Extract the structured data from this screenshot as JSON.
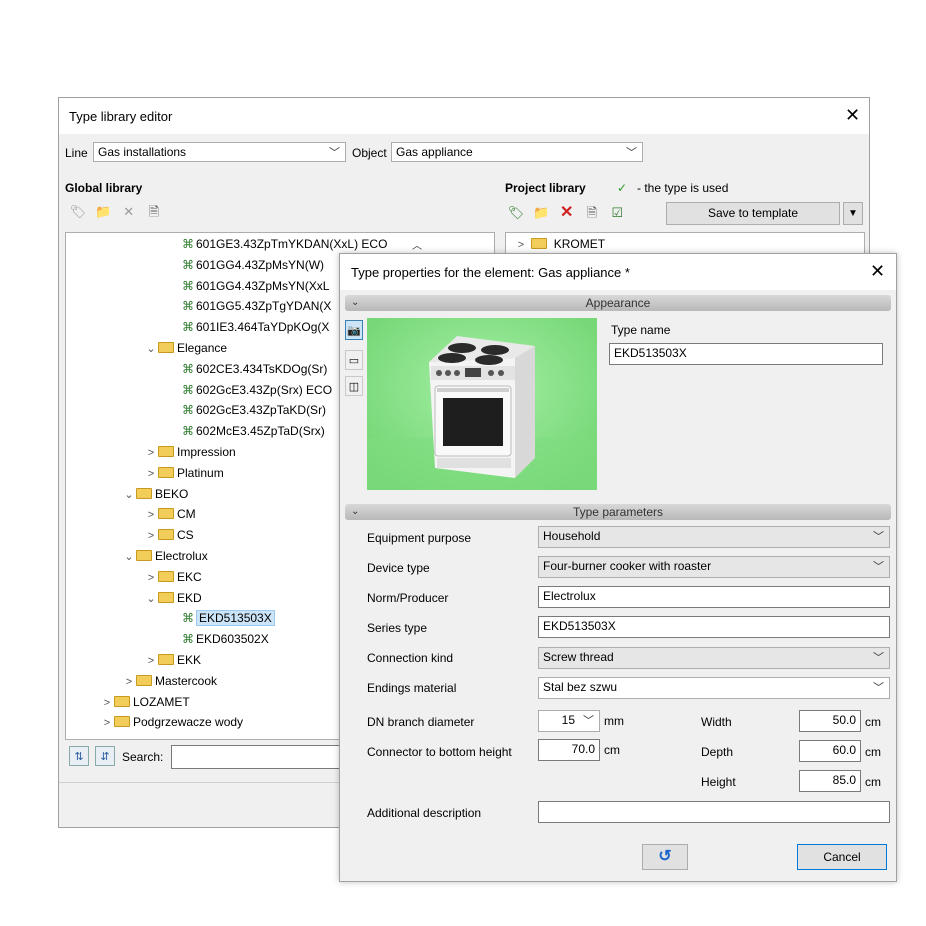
{
  "editor": {
    "title": "Type library editor",
    "line_label": "Line",
    "line_value": "Gas installations",
    "object_label": "Object",
    "object_value": "Gas appliance",
    "global_library_label": "Global library",
    "project_library_label": "Project library",
    "used_check": "✓",
    "used_legend": "- the type is used",
    "save_template_label": "Save to template",
    "search_label": "Search:",
    "search_value": "",
    "global_tree": [
      {
        "label": "601GE3.43ZpTmYKDAN(XxL) ECO",
        "level": 4,
        "kind": "type"
      },
      {
        "label": "601GG4.43ZpMsYN(W)",
        "level": 4,
        "kind": "type"
      },
      {
        "label": "601GG4.43ZpMsYN(XxL",
        "level": 4,
        "kind": "type"
      },
      {
        "label": "601GG5.43ZpTgYDAN(X",
        "level": 4,
        "kind": "type"
      },
      {
        "label": "601IE3.464TaYDpKOg(X",
        "level": 4,
        "kind": "type"
      },
      {
        "label": "Elegance",
        "level": 3,
        "kind": "folder-open"
      },
      {
        "label": "602CE3.434TsKDOg(Sr)",
        "level": 4,
        "kind": "type"
      },
      {
        "label": "602GcE3.43Zp(Srx) ECO",
        "level": 4,
        "kind": "type"
      },
      {
        "label": "602GcE3.43ZpTaKD(Sr)",
        "level": 4,
        "kind": "type"
      },
      {
        "label": "602McE3.45ZpTaD(Srx)",
        "level": 4,
        "kind": "type"
      },
      {
        "label": "Impression",
        "level": 3,
        "kind": "folder"
      },
      {
        "label": "Platinum",
        "level": 3,
        "kind": "folder"
      },
      {
        "label": "BEKO",
        "level": 2,
        "kind": "folder-open"
      },
      {
        "label": "CM",
        "level": 3,
        "kind": "folder"
      },
      {
        "label": "CS",
        "level": 3,
        "kind": "folder"
      },
      {
        "label": "Electrolux",
        "level": 2,
        "kind": "folder-open"
      },
      {
        "label": "EKC",
        "level": 3,
        "kind": "folder"
      },
      {
        "label": "EKD",
        "level": 3,
        "kind": "folder-open"
      },
      {
        "label": "EKD513503X",
        "level": 4,
        "kind": "type-selected"
      },
      {
        "label": "EKD603502X",
        "level": 4,
        "kind": "type"
      },
      {
        "label": "EKK",
        "level": 3,
        "kind": "folder"
      },
      {
        "label": "Mastercook",
        "level": 2,
        "kind": "folder"
      },
      {
        "label": "LOZAMET",
        "level": 1,
        "kind": "folder"
      },
      {
        "label": "Podgrzewacze wody",
        "level": 1,
        "kind": "folder"
      }
    ],
    "project_tree": [
      {
        "label": "KROMET",
        "kind": "folder"
      }
    ]
  },
  "dialog": {
    "title": "Type properties for the element: Gas appliance *",
    "appearance_section": "Appearance",
    "type_name_label": "Type name",
    "type_name_value": "EKD513503X",
    "params_section": "Type parameters",
    "equipment_purpose_label": "Equipment purpose",
    "equipment_purpose_value": "Household",
    "device_type_label": "Device type",
    "device_type_value": "Four-burner cooker with roaster",
    "norm_label": "Norm/Producer",
    "norm_value": "Electrolux",
    "series_label": "Series type",
    "series_value": "EKD513503X",
    "connection_label": "Connection kind",
    "connection_value": "Screw thread",
    "endings_label": "Endings material",
    "endings_value": "Stal bez szwu",
    "dn_label": "DN branch diameter",
    "dn_value": "15",
    "dn_unit": "mm",
    "connector_label": "Connector to bottom height",
    "connector_value": "70.0",
    "connector_unit": "cm",
    "width_label": "Width",
    "width_value": "50.0",
    "depth_label": "Depth",
    "depth_value": "60.0",
    "height_label": "Height",
    "height_value": "85.0",
    "dim_unit": "cm",
    "additional_label": "Additional description",
    "additional_value": "",
    "cancel_label": "Cancel",
    "image_bg_color": "#8fe68f"
  }
}
